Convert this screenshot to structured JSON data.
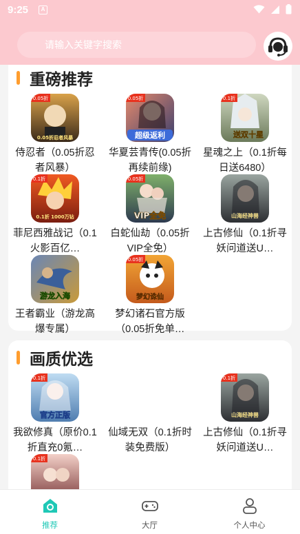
{
  "status_bar": {
    "time": "9:25",
    "app_badge": "A"
  },
  "search": {
    "placeholder": "请输入关键字搜索"
  },
  "sections": [
    {
      "title": "重磅推荐",
      "games": [
        {
          "name": "侍忍者（0.05折忍者风暴）",
          "badge": "0.05折",
          "caption": "0.05折忍者风暴",
          "colors": [
            "#d9a24a",
            "#3a2a1a"
          ]
        },
        {
          "name": "华夏芸青传(0.05折再续前缘)",
          "badge": "0.05折",
          "caption": "超级返利",
          "colors": [
            "#e58a6b",
            "#3b3f6e"
          ]
        },
        {
          "name": "星魂之上（0.1折每日送6480）",
          "badge": "0.1折",
          "caption": "送双十星",
          "colors": [
            "#cfd7c0",
            "#6b7a5a"
          ]
        },
        {
          "name": "菲尼西雅战记（0.1火影百亿…",
          "badge": "0.1折",
          "caption": "0.1折 1000万钻",
          "colors": [
            "#f05a22",
            "#7a1d10"
          ]
        },
        {
          "name": "白蛇仙劫（0.05折VIP全免）",
          "badge": "0.05折",
          "caption": "VIP全免",
          "colors": [
            "#7fb06a",
            "#2d3a4f"
          ]
        },
        {
          "name": "上古修仙（0.1折寻妖问道送U…",
          "badge": "0.1折",
          "caption": "山海经神兽",
          "colors": [
            "#9aa5a0",
            "#2d2f33"
          ]
        },
        {
          "name": "王者霸业（游龙高爆专属）",
          "badge": "",
          "caption": "游龙入海",
          "colors": [
            "#6a86b5",
            "#c99a3a"
          ]
        },
        {
          "name": "梦幻诸石官方版（0.05折免单…",
          "badge": "0.05折",
          "caption": "梦幻诛仙",
          "colors": [
            "#f2a535",
            "#c45a1c"
          ]
        }
      ]
    },
    {
      "title": "画质优选",
      "games": [
        {
          "name": "我欲修真（原价0.1折直充0氪…",
          "badge": "0.1折",
          "caption": "官方正版",
          "colors": [
            "#bfdcf2",
            "#4f7db0"
          ]
        },
        {
          "name": "仙域无双（0.1折时装免费版）",
          "badge": "",
          "caption": "",
          "colors": [
            "#ffffff",
            "#ffffff"
          ]
        },
        {
          "name": "上古修仙（0.1折寻妖问道送U…",
          "badge": "0.1折",
          "caption": "山海经神兽",
          "colors": [
            "#9aa5a0",
            "#2d2f33"
          ]
        },
        {
          "name": "",
          "badge": "0.1折",
          "caption": "",
          "colors": [
            "#f3d0c8",
            "#7a3a3a"
          ]
        }
      ]
    }
  ],
  "tabs": [
    {
      "label": "推荐",
      "icon": "home-icon",
      "active": true
    },
    {
      "label": "大厅",
      "icon": "gamepad-icon",
      "active": false
    },
    {
      "label": "个人中心",
      "icon": "person-icon",
      "active": false
    }
  ],
  "colors": {
    "header_bg": "#fcc9cf",
    "accent": "#1fc8b6",
    "section_bar": "#ff9d2e"
  }
}
